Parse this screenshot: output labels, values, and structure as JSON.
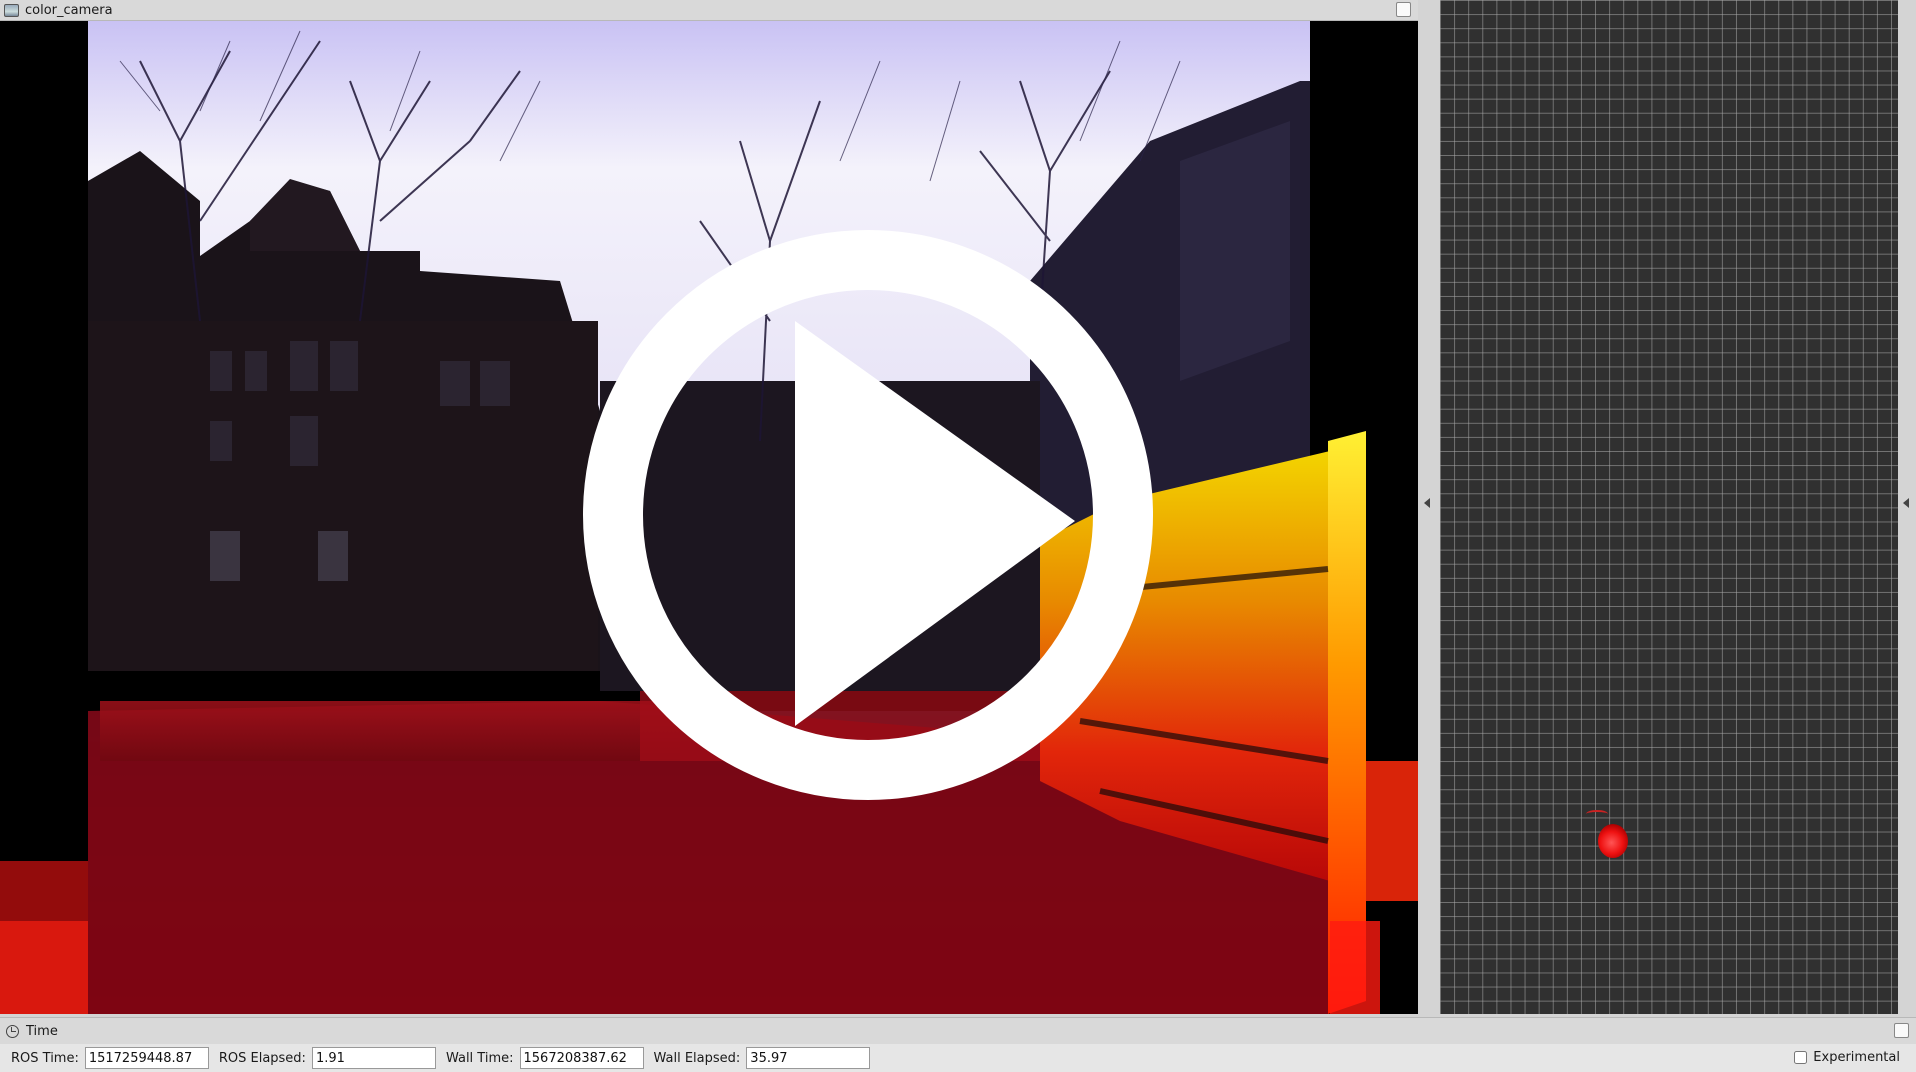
{
  "image_panel": {
    "title": "color_camera",
    "title_icon": "image-view-icon",
    "overlay_icon": "play-icon"
  },
  "time_panel": {
    "title": "Time",
    "title_icon": "clock-icon",
    "ros_time_label": "ROS Time:",
    "ros_time": "1517259448.87",
    "ros_elapsed_label": "ROS Elapsed:",
    "ros_elapsed": "1.91",
    "wall_time_label": "Wall Time:",
    "wall_time": "1567208387.62",
    "wall_elapsed_label": "Wall Elapsed:",
    "wall_elapsed": "35.97",
    "experimental_label": "Experimental",
    "experimental_checked": false
  }
}
